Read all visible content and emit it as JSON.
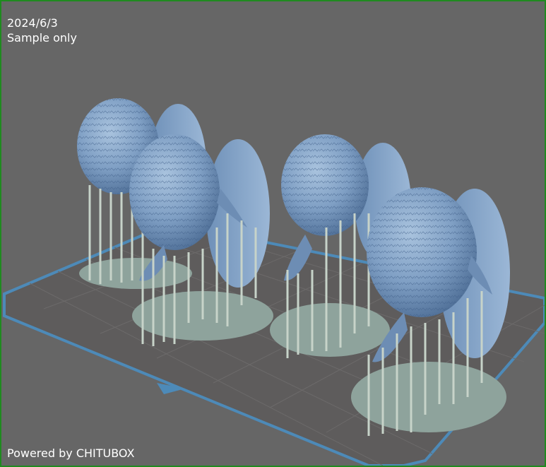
{
  "overlay": {
    "date": "2024/6/3",
    "note": "Sample only",
    "powered_by": "Powered by CHITUBOX"
  },
  "colors": {
    "background": "#666666",
    "window_border": "#1f8a1f",
    "plate_grid": "#5a5858",
    "plate_border": "#4d8ab8",
    "model_body": "#7f9fc4",
    "model_shadow": "#5d7ea6",
    "support": "#c7d3c9",
    "raft": "#8ea39c",
    "text": "#ffffff"
  },
  "scene": {
    "object_type": "resin 3D print preview",
    "model_count": 4,
    "icons": [
      "build-plate-icon",
      "support-structure-icon"
    ]
  }
}
